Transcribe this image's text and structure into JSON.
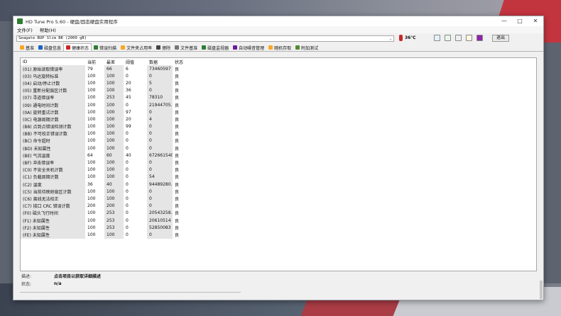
{
  "window": {
    "title": "HD Tune Pro 5.60 - 硬盘/固态硬盘实用程序",
    "controls": {
      "minimize": "—",
      "maximize": "□",
      "close": "✕"
    }
  },
  "menu": [
    "文件(F)",
    "帮助(H)"
  ],
  "drive": {
    "selected": "Seagate BUP Slim BK (2000 gB)",
    "temperature": "36℃",
    "exit_label": "退出"
  },
  "tabs": [
    {
      "label": "基准",
      "color": "#f9a825"
    },
    {
      "label": "磁盘信息",
      "color": "#1565c0"
    },
    {
      "label": "健康状态",
      "color": "#c62828",
      "active": true
    },
    {
      "label": "错误扫描",
      "color": "#2e7d32"
    },
    {
      "label": "文件夹占用率",
      "color": "#f9a825"
    },
    {
      "label": "擦除",
      "color": "#424242"
    },
    {
      "label": "文件基准",
      "color": "#757575"
    },
    {
      "label": "磁盘监视器",
      "color": "#2e7d32"
    },
    {
      "label": "自动噪音管理",
      "color": "#6a1b9a"
    },
    {
      "label": "随机存取",
      "color": "#f9a825"
    },
    {
      "label": "附加测试",
      "color": "#558b2f"
    }
  ],
  "table": {
    "headers": [
      "ID",
      "当前",
      "最差",
      "阈值",
      "数据",
      "状态"
    ],
    "rows": [
      [
        "(01) 原始读取错误率",
        "79",
        "66",
        "6",
        "73460597",
        "良"
      ],
      [
        "(03) 马达旋转标准",
        "100",
        "100",
        "0",
        "0",
        "良"
      ],
      [
        "(04) 启动/停止计数",
        "100",
        "100",
        "20",
        "5",
        "良"
      ],
      [
        "(05) 重新分配扇区计数",
        "100",
        "100",
        "36",
        "0",
        "良"
      ],
      [
        "(07) 寻道错误率",
        "100",
        "253",
        "45",
        "78310",
        "良"
      ],
      [
        "(09) 通电时间计数",
        "100",
        "100",
        "0",
        "21944705...",
        "良"
      ],
      [
        "(0A) 旋转重试计数",
        "100",
        "100",
        "97",
        "0",
        "良"
      ],
      [
        "(0C) 电源周期计数",
        "100",
        "100",
        "20",
        "4",
        "良"
      ],
      [
        "(B8) 点到点错误检测计数",
        "100",
        "100",
        "99",
        "0",
        "良"
      ],
      [
        "(BB) 不可校正错误计数",
        "100",
        "100",
        "0",
        "0",
        "良"
      ],
      [
        "(BC) 命令超时",
        "100",
        "100",
        "0",
        "0",
        "良"
      ],
      [
        "(BD) 未知属性",
        "100",
        "100",
        "0",
        "0",
        "良"
      ],
      [
        "(BE) 气流温度",
        "64",
        "60",
        "40",
        "672661540",
        "良"
      ],
      [
        "(BF) 冲击错误率",
        "100",
        "100",
        "0",
        "0",
        "良"
      ],
      [
        "(C0) 不安全关机计数",
        "100",
        "100",
        "0",
        "0",
        "良"
      ],
      [
        "(C1) 负载周期计数",
        "100",
        "100",
        "0",
        "54",
        "良"
      ],
      [
        "(C2) 温度",
        "36",
        "40",
        "0",
        "94489280...",
        "良"
      ],
      [
        "(C5) 当前待映射扇区计数",
        "100",
        "100",
        "0",
        "0",
        "良"
      ],
      [
        "(C6) 离线无法校正",
        "100",
        "100",
        "0",
        "0",
        "良"
      ],
      [
        "(C7) 接口 CRC 错误计数",
        "200",
        "200",
        "0",
        "0",
        "良"
      ],
      [
        "(F0) 磁头飞行时间",
        "100",
        "253",
        "0",
        "20543258...",
        "良"
      ],
      [
        "(F1) 未知属性",
        "100",
        "253",
        "0",
        "20610514",
        "良"
      ],
      [
        "(F2) 未知属性",
        "100",
        "253",
        "0",
        "52850083",
        "良"
      ],
      [
        "(FE) 未知属性",
        "100",
        "100",
        "0",
        "0",
        "良"
      ]
    ]
  },
  "info": {
    "desc_label": "描述:",
    "desc_value": "点击项目以获取详细描述",
    "status_label": "状态:",
    "status_value": "n/a"
  }
}
